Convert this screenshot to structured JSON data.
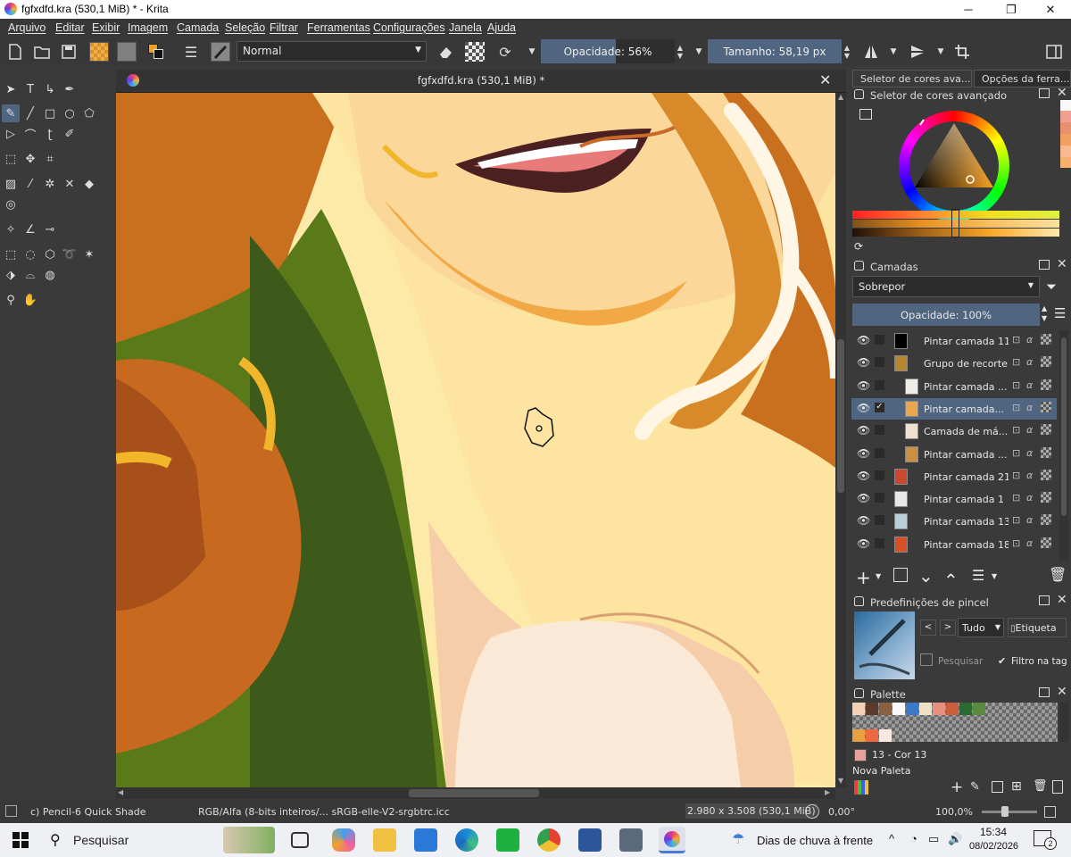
{
  "window": {
    "title": "fgfxdfd.kra (530,1 MiB) * - Krita",
    "controls": [
      "─",
      "❐",
      "✕"
    ]
  },
  "menu": [
    "Arquivo",
    "Editar",
    "Exibir",
    "Imagem",
    "Camada",
    "Seleção",
    "Filtrar",
    "Ferramentas",
    "Configurações",
    "Janela",
    "Ajuda"
  ],
  "toolbar": {
    "blend_mode": "Normal",
    "opacity_label": "Opacidade: 56%",
    "opacity_value": 0.56,
    "size_label": "Tamanho: 58,19 px"
  },
  "document": {
    "tab_title": "fgfxdfd.kra (530,1 MiB) *",
    "close": "✕"
  },
  "dock": {
    "tabs": [
      "Seletor de cores ava...",
      "Opções da ferra..."
    ],
    "color_selector_title": "Seletor de cores avançado",
    "layers_title": "Camadas",
    "layer_blend_mode": "Sobrepor",
    "layer_opacity_label": "Opacidade:  100%",
    "layers": [
      {
        "name": "Pintar camada 11",
        "thumb_color": "#000000",
        "selected": false
      },
      {
        "name": "Grupo de recorte...",
        "thumb_color": "#b8862e",
        "selected": false
      },
      {
        "name": "Pintar camada ...",
        "thumb_color": "#f0ece8",
        "selected": false
      },
      {
        "name": "Pintar camada...",
        "thumb_color": "#e8a850",
        "selected": true
      },
      {
        "name": "Camada de má...",
        "thumb_color": "#f0e0d0",
        "selected": false
      },
      {
        "name": "Pintar camada ...",
        "thumb_color": "#c89040",
        "selected": false
      },
      {
        "name": "Pintar camada 21",
        "thumb_color": "#c84830",
        "selected": false
      },
      {
        "name": "Pintar camada 1",
        "thumb_color": "#e8e8e8",
        "selected": false
      },
      {
        "name": "Pintar camada 13",
        "thumb_color": "#b8d0d8",
        "selected": false
      },
      {
        "name": "Pintar camada 18",
        "thumb_color": "#d85028",
        "selected": false
      }
    ],
    "brush_presets_title": "Predefinições de pincel",
    "brush_filter": "Tudo",
    "brush_tag": "Etiqueta",
    "brush_search_placeholder": "Pesquisar",
    "brush_filter_tag": "Filtro na tag",
    "palette_title": "Palette",
    "palette_row1": [
      "#f5d0b8",
      "#5a3a28",
      "#8a6040",
      "#f8f8f8",
      "#3a7ac8",
      "#f0e0c8",
      "#e89080",
      "#c86040",
      "#2a6a30",
      "#5a8a40"
    ],
    "palette_row3": [
      "#e8a040",
      "#f06840",
      "#f8e8e0"
    ],
    "current_color_label": "13 - Cor 13",
    "new_palette": "Nova Paleta"
  },
  "status": {
    "brush": "c) Pencil-6 Quick Shade",
    "color_space": "RGB/Alfa (8-bits inteiros/...  sRGB-elle-V2-srgbtrc.icc",
    "dimensions": "2.980 x 3.508 (530,1 MiB)",
    "rotation": "0,00°",
    "zoom": "100,0%"
  },
  "taskbar": {
    "search_placeholder": "Pesquisar",
    "weather": "Dias de chuva à frente",
    "time": "15:34",
    "date": "08/02/2026",
    "notifications": "2"
  }
}
